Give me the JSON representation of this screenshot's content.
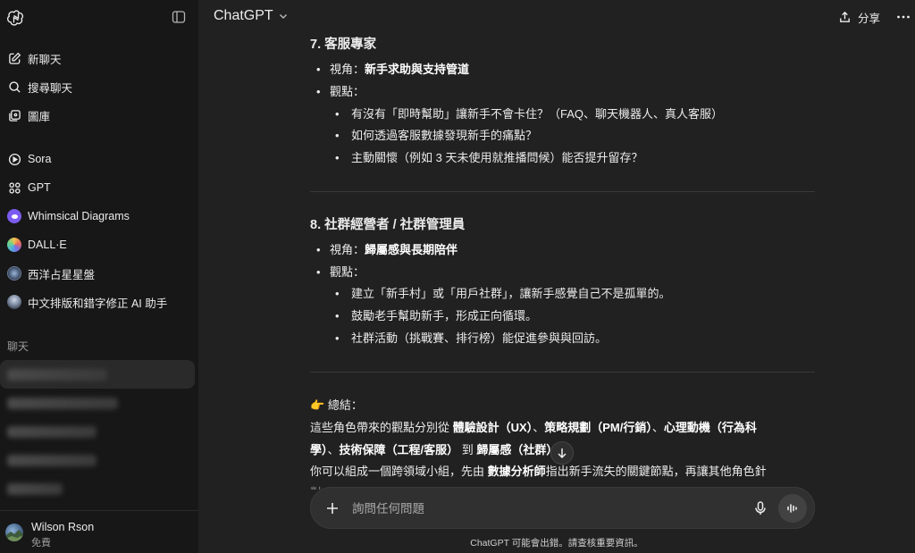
{
  "sidebar": {
    "nav": [
      {
        "label": "新聊天",
        "icon": "edit-icon"
      },
      {
        "label": "搜尋聊天",
        "icon": "search-icon"
      },
      {
        "label": "圖庫",
        "icon": "images-icon"
      }
    ],
    "apps": [
      {
        "label": "Sora",
        "icon": "play-circle-icon"
      },
      {
        "label": "GPT",
        "icon": "grid-icon"
      },
      {
        "label": "Whimsical Diagrams",
        "icon": "whimsical-icon"
      },
      {
        "label": "DALL·E",
        "icon": "dalle-icon"
      },
      {
        "label": "西洋占星星盤",
        "icon": "astrology-icon"
      },
      {
        "label": "中文排版和錯字修正 AI 助手",
        "icon": "typography-icon"
      }
    ],
    "chats_label": "聊天",
    "user": {
      "name": "Wilson Rson",
      "plan": "免費"
    }
  },
  "header": {
    "model": "ChatGPT",
    "share_label": "分享"
  },
  "message": {
    "s7": {
      "title": "7. 客服專家",
      "view_prefix": "視角：",
      "view_bold": "新手求助與支持管道",
      "points_label": "觀點：",
      "points": [
        "有沒有「即時幫助」讓新手不會卡住？（FAQ、聊天機器人、真人客服）",
        "如何透過客服數據發現新手的痛點？",
        "主動關懷（例如 3 天未使用就推播問候）能否提升留存？"
      ]
    },
    "s8": {
      "title": "8. 社群經營者 / 社群管理員",
      "view_prefix": "視角：",
      "view_bold": "歸屬感與長期陪伴",
      "points_label": "觀點：",
      "points": [
        "建立「新手村」或「用戶社群」，讓新手感覺自己不是孤單的。",
        "鼓勵老手幫助新手，形成正向循環。",
        "社群活動（挑戰賽、排行榜）能促進參與與回訪。"
      ]
    },
    "summary": {
      "emoji": "👉",
      "label": "總結：",
      "line1_a": "這些角色帶來的觀點分別從 ",
      "line1_b1": "體驗設計（UX）",
      "line1_c": "、",
      "line1_b2": "策略規劃（PM/行銷）",
      "line1_d": "、",
      "line1_b3": "心理動機（行為科",
      "line2_b3": "學）",
      "line2_c": "、",
      "line2_b4": "技術保障（工程/客服）",
      "line2_d": " 到 ",
      "line2_b5": "歸屬感（社群）",
      "line2_e": "。",
      "line3_a": "你可以組成一個跨領域小組，先由 ",
      "line3_b": "數據分析師",
      "line3_c": "指出新手流失的關鍵節點，再讓其他角色針",
      "line4": "對"
    }
  },
  "composer": {
    "placeholder": "詢問任何問題"
  },
  "footer": {
    "disclaimer": "ChatGPT 可能會出錯。請查核重要資訊。"
  }
}
